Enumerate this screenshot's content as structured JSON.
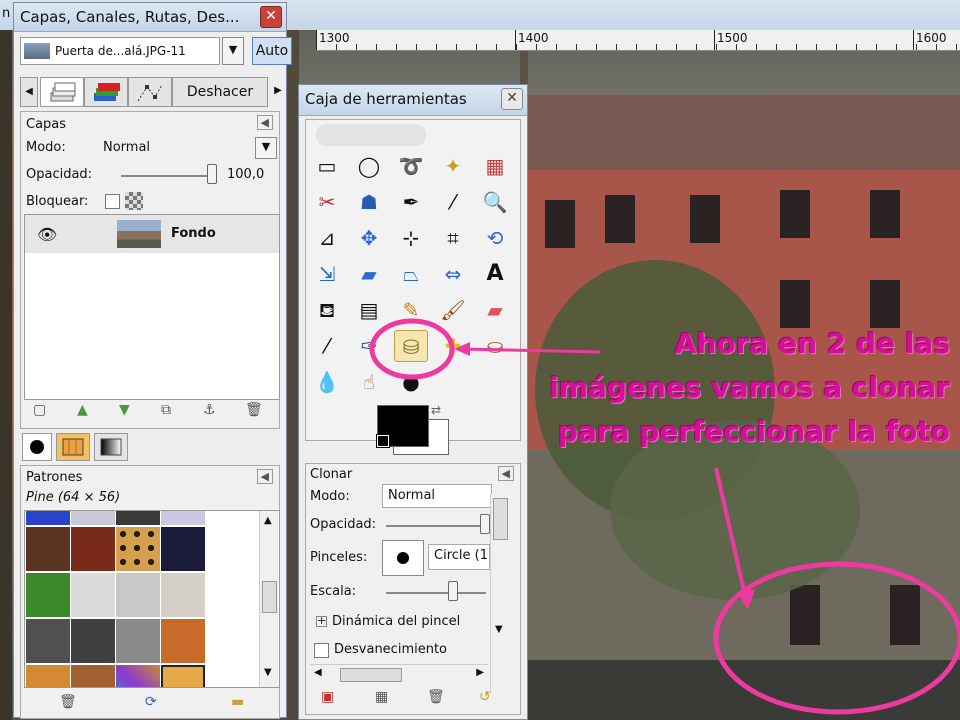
{
  "topbar": {
    "fragment": "n"
  },
  "ruler": {
    "ticks": [
      "1300",
      "1400",
      "1500",
      "1600"
    ]
  },
  "layers_dialog": {
    "title": "Capas, Canales, Rutas, Des...",
    "close": "✕",
    "image_selector": "Puerta de...alá.JPG-11",
    "auto_button": "Auto",
    "undo_tab": "Deshacer",
    "layers_section": {
      "title": "Capas",
      "mode_label": "Modo:",
      "mode_value": "Normal",
      "opacity_label": "Opacidad:",
      "opacity_value": "100,0",
      "lock_label": "Bloquear:",
      "layer_name": "Fondo"
    },
    "patterns_section": {
      "title": "Patrones",
      "current": "Pine (64 × 56)"
    }
  },
  "toolbox": {
    "title": "Caja de herramientas",
    "close": "✕",
    "options": {
      "title": "Clonar",
      "mode_label": "Modo:",
      "mode_value": "Normal",
      "opacity_label": "Opacidad:",
      "brushes_label": "Pinceles:",
      "brush_value": "Circle (1",
      "scale_label": "Escala:",
      "dynamics": "Dinámica del pincel",
      "fade": "Desvanecimiento"
    }
  },
  "annotation": {
    "lines": [
      "Ahora en 2 de las",
      "imágenes vamos a clonar",
      "para perfeccionar la foto"
    ],
    "color": "#d4109a"
  }
}
